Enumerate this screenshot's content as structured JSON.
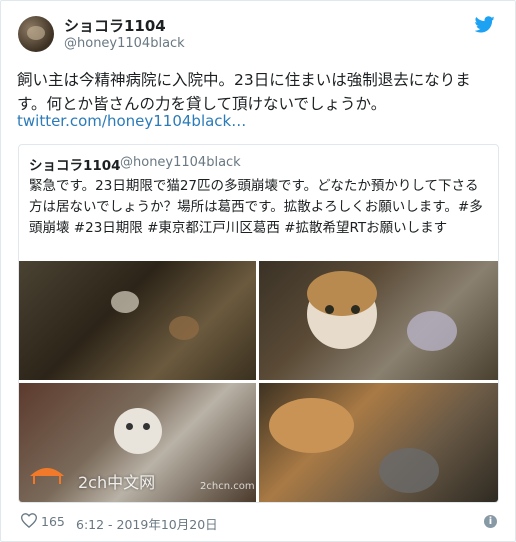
{
  "author": {
    "display_name": "ショコラ1104",
    "handle": "@honey1104black"
  },
  "tweet": {
    "text": "飼い主は今精神病院に入院中。23日に住まいは強制退去になります。何とか皆さんの力を貸して頂けないでしょうか。",
    "link": "twitter.com/honey1104black…"
  },
  "quoted": {
    "display_name": "ショコラ1104",
    "handle": "@honey1104black",
    "text": "緊急です。23日期限で猫27匹の多頭崩壊です。どなたか預かりして下さる方は居ないでしょうか？場所は葛西です。拡散よろしくお願いします。#多頭崩壊 #23日期限 #東京都江戸川区葛西 #拡散希望RTお願いします"
  },
  "watermark": {
    "text": "2ch中文网",
    "small": "2chcn.com"
  },
  "footer": {
    "like_count": "165",
    "timestamp": "6:12 - 2019年10月20日"
  },
  "colors": {
    "link": "#2b7bb9",
    "twitter_blue": "#1da1f2",
    "muted": "#697882"
  },
  "icons": [
    "twitter-bird-icon",
    "heart-icon",
    "info-icon"
  ]
}
